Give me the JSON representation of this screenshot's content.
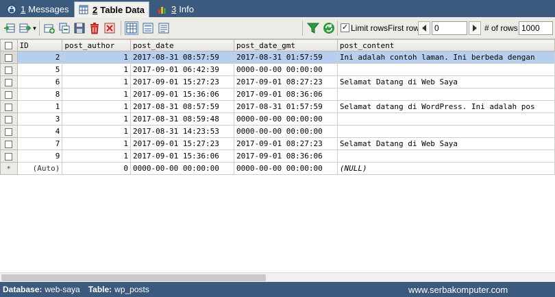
{
  "tabs": [
    {
      "num": "1",
      "label": "Messages"
    },
    {
      "num": "2",
      "label": "Table Data"
    },
    {
      "num": "3",
      "label": "Info"
    }
  ],
  "toolbar": {
    "limit_label": "Limit rows",
    "limit_checked": true,
    "first_row_label": "First row",
    "first_row_value": "0",
    "num_rows_label": "# of rows",
    "num_rows_value": "1000"
  },
  "table": {
    "columns": [
      "ID",
      "post_author",
      "post_date",
      "post_date_gmt",
      "post_content"
    ],
    "rows": [
      [
        "2",
        "1",
        "2017-08-31 08:57:59",
        "2017-08-31 01:57:59",
        "Ini adalah contoh laman. Ini berbeda dengan"
      ],
      [
        "5",
        "1",
        "2017-09-01 06:42:39",
        "0000-00-00 00:00:00",
        ""
      ],
      [
        "6",
        "1",
        "2017-09-01 15:27:23",
        "2017-09-01 08:27:23",
        "Selamat Datang di Web Saya"
      ],
      [
        "8",
        "1",
        "2017-09-01 15:36:06",
        "2017-09-01 08:36:06",
        ""
      ],
      [
        "1",
        "1",
        "2017-08-31 08:57:59",
        "2017-08-31 01:57:59",
        "Selamat datang di WordPress. Ini adalah pos"
      ],
      [
        "3",
        "1",
        "2017-08-31 08:59:48",
        "0000-00-00 00:00:00",
        ""
      ],
      [
        "4",
        "1",
        "2017-08-31 14:23:53",
        "0000-00-00 00:00:00",
        ""
      ],
      [
        "7",
        "1",
        "2017-09-01 15:27:23",
        "2017-09-01 08:27:23",
        "Selamat Datang di Web Saya"
      ],
      [
        "9",
        "1",
        "2017-09-01 15:36:06",
        "2017-09-01 08:36:06",
        ""
      ]
    ],
    "selected_row_index": 0,
    "new_row": {
      "marker": "*",
      "values": [
        "(Auto)",
        "0",
        "0000-00-00 00:00:00",
        "0000-00-00 00:00:00",
        "(NULL)"
      ]
    }
  },
  "status": {
    "database_label": "Database:",
    "database_value": "web-saya",
    "table_label": "Table:",
    "table_value": "wp_posts",
    "website": "www.serbakomputer.com"
  },
  "colors": {
    "bar_blue": "#3c5a7e",
    "selection": "#b7cfee"
  }
}
